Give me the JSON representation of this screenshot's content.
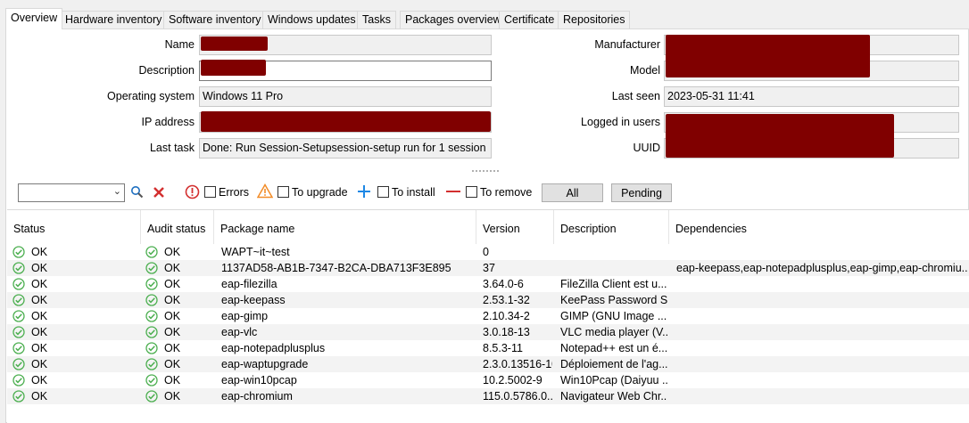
{
  "tabs": [
    {
      "label": "Overview",
      "active": true
    },
    {
      "label": "Hardware inventory",
      "active": false
    },
    {
      "label": "Software inventory",
      "active": false
    },
    {
      "label": "Windows updates",
      "active": false
    },
    {
      "label": "Tasks",
      "active": false
    },
    {
      "label": "Packages overview",
      "active": false
    },
    {
      "label": "Certificate",
      "active": false
    },
    {
      "label": "Repositories",
      "active": false
    }
  ],
  "form": {
    "name_label": "Name",
    "description_label": "Description",
    "os_label": "Operating system",
    "os_value": "Windows 11 Pro",
    "ip_label": "IP address",
    "last_task_label": "Last task",
    "last_task_value": "Done: Run Session-Setupsession-setup run for 1 session",
    "manufacturer_label": "Manufacturer",
    "model_label": "Model",
    "last_seen_label": "Last seen",
    "last_seen_value": "2023-05-31 11:41",
    "logged_in_label": "Logged in users",
    "uuid_label": "UUID"
  },
  "filters": {
    "errors_label": "Errors",
    "upgrade_label": "To upgrade",
    "install_label": "To install",
    "remove_label": "To remove",
    "all_button": "All",
    "pending_button": "Pending"
  },
  "colors": {
    "redaction": "#800000",
    "ok_green": "#4caf50",
    "error_red": "#d32f2f",
    "warning_orange": "#f28c28",
    "install_blue": "#1e88e5"
  },
  "grid": {
    "headers": {
      "status": "Status",
      "audit": "Audit status",
      "package": "Package name",
      "version": "Version",
      "description": "Description",
      "dependencies": "Dependencies"
    },
    "rows": [
      {
        "status": "OK",
        "audit": "OK",
        "package": "WAPT~it~test",
        "version": "0",
        "description": "",
        "dependencies": ""
      },
      {
        "status": "OK",
        "audit": "OK",
        "package": "1137AD58-AB1B-7347-B2CA-DBA713F3E895",
        "version": "37",
        "description": "",
        "dependencies": "eap-keepass,eap-notepadplusplus,eap-gimp,eap-chromiu..."
      },
      {
        "status": "OK",
        "audit": "OK",
        "package": "eap-filezilla",
        "version": "3.64.0-6",
        "description": "FileZilla Client est u...",
        "dependencies": ""
      },
      {
        "status": "OK",
        "audit": "OK",
        "package": "eap-keepass",
        "version": "2.53.1-32",
        "description": "KeePass Password S...",
        "dependencies": ""
      },
      {
        "status": "OK",
        "audit": "OK",
        "package": "eap-gimp",
        "version": "2.10.34-2",
        "description": "GIMP (GNU Image ...",
        "dependencies": ""
      },
      {
        "status": "OK",
        "audit": "OK",
        "package": "eap-vlc",
        "version": "3.0.18-13",
        "description": "VLC media player (V...",
        "dependencies": ""
      },
      {
        "status": "OK",
        "audit": "OK",
        "package": "eap-notepadplusplus",
        "version": "8.5.3-11",
        "description": "Notepad++ est un é...",
        "dependencies": ""
      },
      {
        "status": "OK",
        "audit": "OK",
        "package": "eap-waptupgrade",
        "version": "2.3.0.13516-10",
        "description": "Déploiement de l'ag...",
        "dependencies": ""
      },
      {
        "status": "OK",
        "audit": "OK",
        "package": "eap-win10pcap",
        "version": "10.2.5002-9",
        "description": "Win10Pcap (Daiyuu ...",
        "dependencies": ""
      },
      {
        "status": "OK",
        "audit": "OK",
        "package": "eap-chromium",
        "version": "115.0.5786.0...",
        "description": "Navigateur Web Chr...",
        "dependencies": ""
      }
    ]
  }
}
